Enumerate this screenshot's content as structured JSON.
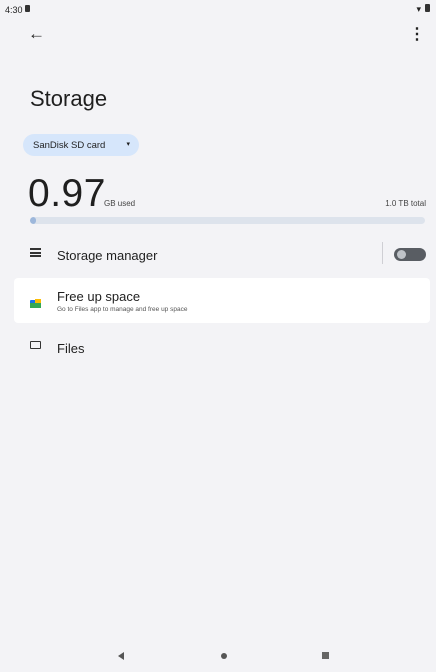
{
  "status_bar": {
    "time": "4:30"
  },
  "header": {
    "back_icon": "arrow-left-icon",
    "menu_icon": "more-vert-icon"
  },
  "page": {
    "title": "Storage"
  },
  "storage_select": {
    "selected": "SanDisk SD card",
    "caret": "▾"
  },
  "usage": {
    "used_value": "0.97",
    "used_unit": "GB used",
    "total_text": "1.0 TB total",
    "fill_fraction": 0.001
  },
  "items": {
    "storage_manager": {
      "label": "Storage manager",
      "toggle_on": false
    },
    "free_up": {
      "label": "Free up space",
      "sublabel": "Go to Files app to manage and free up space"
    },
    "files": {
      "label": "Files"
    }
  },
  "colors": {
    "background": "#f3f3f6",
    "chip_bg": "#d6e6fb",
    "bar_track": "#dde3ec",
    "toggle_track": "#595d63"
  }
}
